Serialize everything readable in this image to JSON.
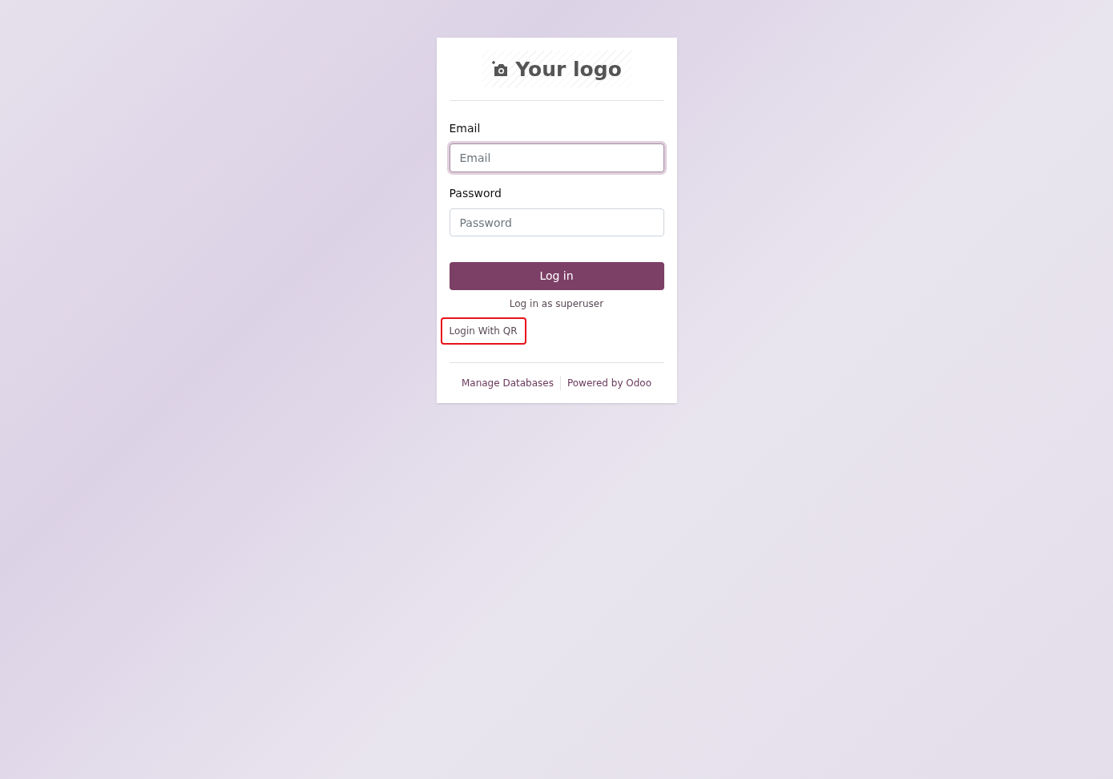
{
  "logo": {
    "text": "Your logo"
  },
  "fields": [
    {
      "label": "Email",
      "placeholder": "Email",
      "focused": true
    },
    {
      "label": "Password",
      "placeholder": "Password",
      "focused": false
    }
  ],
  "login_button": "Log in",
  "superuser_link": "Log in as superuser",
  "qr_link": {
    "text": "Login With QR",
    "highlighted": true
  },
  "footer_links": [
    "Manage Databases",
    "Powered by Odoo"
  ]
}
